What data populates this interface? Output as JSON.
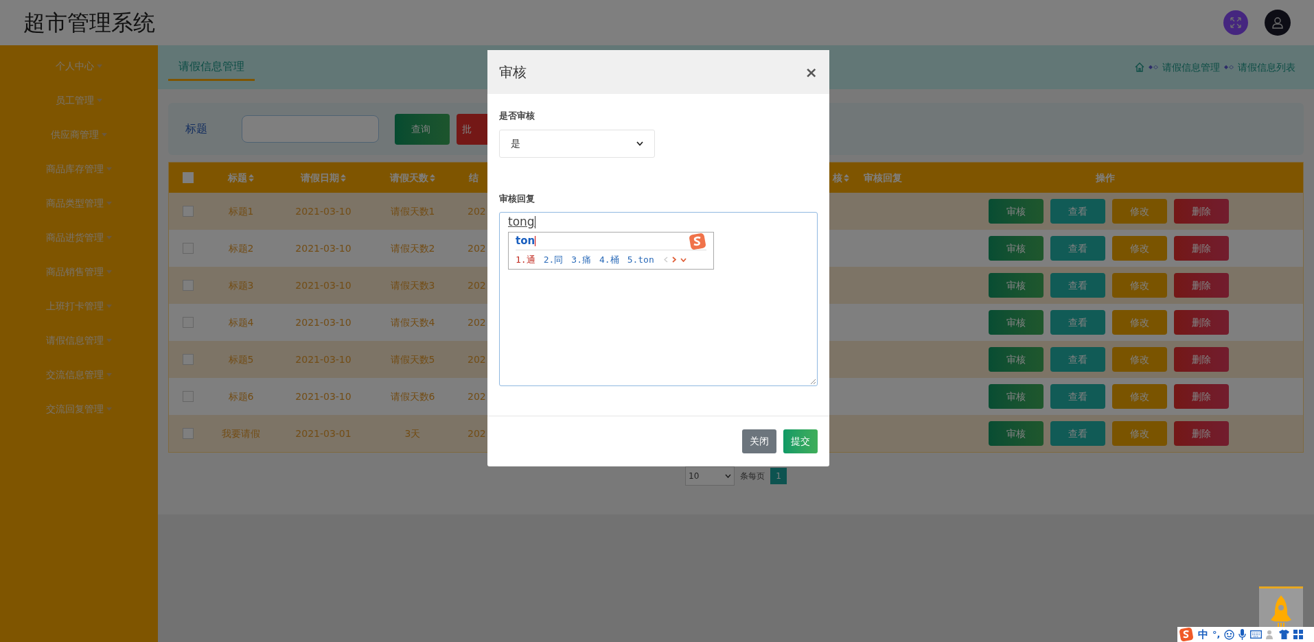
{
  "header": {
    "title": "超市管理系统"
  },
  "sidebar": {
    "items": [
      {
        "label": "个人中心"
      },
      {
        "label": "员工管理"
      },
      {
        "label": "供应商管理"
      },
      {
        "label": "商品库存管理"
      },
      {
        "label": "商品类型管理"
      },
      {
        "label": "商品进货管理"
      },
      {
        "label": "商品销售管理"
      },
      {
        "label": "上班打卡管理"
      },
      {
        "label": "请假信息管理"
      },
      {
        "label": "交流信息管理"
      },
      {
        "label": "交流回复管理"
      }
    ]
  },
  "tabs": [
    {
      "label": "请假信息管理",
      "selected": true
    }
  ],
  "breadcrumb": [
    "请假信息管理",
    "请假信息列表"
  ],
  "search": {
    "label": "标题",
    "buttons": [
      {
        "label": "查询",
        "kind": "query"
      },
      {
        "label": "批",
        "kind": "batch"
      }
    ]
  },
  "table": {
    "checked": false,
    "columns": [
      {
        "label": "标题",
        "sortable": true
      },
      {
        "label": "请假日期",
        "sortable": true
      },
      {
        "label": "请假天数",
        "sortable": true
      },
      {
        "label": "结",
        "sortable": false
      },
      {
        "label": "核",
        "sortable": true
      },
      {
        "label": "审核回复",
        "sortable": false
      },
      {
        "label": "操作",
        "sortable": false
      }
    ],
    "rows": [
      {
        "checked": false,
        "cells": [
          "标题1",
          "2021-03-10",
          "请假天数1",
          "202"
        ],
        "actions": [
          {
            "label": "审核",
            "kind": "review"
          },
          {
            "label": "查看",
            "kind": "view"
          },
          {
            "label": "修改",
            "kind": "edit"
          },
          {
            "label": "删除",
            "kind": "delete"
          }
        ]
      },
      {
        "checked": false,
        "cells": [
          "标题2",
          "2021-03-10",
          "请假天数2",
          "202"
        ],
        "actions": [
          {
            "label": "审核",
            "kind": "review"
          },
          {
            "label": "查看",
            "kind": "view"
          },
          {
            "label": "修改",
            "kind": "edit"
          },
          {
            "label": "删除",
            "kind": "delete"
          }
        ]
      },
      {
        "checked": false,
        "cells": [
          "标题3",
          "2021-03-10",
          "请假天数3",
          "202"
        ],
        "actions": [
          {
            "label": "审核",
            "kind": "review"
          },
          {
            "label": "查看",
            "kind": "view"
          },
          {
            "label": "修改",
            "kind": "edit"
          },
          {
            "label": "删除",
            "kind": "delete"
          }
        ]
      },
      {
        "checked": false,
        "cells": [
          "标题4",
          "2021-03-10",
          "请假天数4",
          "202"
        ],
        "actions": [
          {
            "label": "审核",
            "kind": "review"
          },
          {
            "label": "查看",
            "kind": "view"
          },
          {
            "label": "修改",
            "kind": "edit"
          },
          {
            "label": "删除",
            "kind": "delete"
          }
        ]
      },
      {
        "checked": false,
        "cells": [
          "标题5",
          "2021-03-10",
          "请假天数5",
          "202"
        ],
        "actions": [
          {
            "label": "审核",
            "kind": "review"
          },
          {
            "label": "查看",
            "kind": "view"
          },
          {
            "label": "修改",
            "kind": "edit"
          },
          {
            "label": "删除",
            "kind": "delete"
          }
        ]
      },
      {
        "checked": false,
        "cells": [
          "标题6",
          "2021-03-10",
          "请假天数6",
          "202"
        ],
        "actions": [
          {
            "label": "审核",
            "kind": "review"
          },
          {
            "label": "查看",
            "kind": "view"
          },
          {
            "label": "修改",
            "kind": "edit"
          },
          {
            "label": "删除",
            "kind": "delete"
          }
        ]
      },
      {
        "checked": false,
        "cells": [
          "我要请假",
          "2021-03-01",
          "3天",
          "202"
        ],
        "actions": [
          {
            "label": "审核",
            "kind": "review"
          },
          {
            "label": "查看",
            "kind": "view"
          },
          {
            "label": "修改",
            "kind": "edit"
          },
          {
            "label": "删除",
            "kind": "delete"
          }
        ]
      }
    ]
  },
  "pagination": {
    "page_size": "10",
    "page_size_label": "条每页",
    "pages": [
      {
        "label": "1",
        "selected": true
      }
    ]
  },
  "modal": {
    "title": "审核",
    "close": "×",
    "fields": [
      {
        "kind": "select",
        "label": "是否审核",
        "value": "是"
      },
      {
        "kind": "textarea",
        "label": "审核回复",
        "value": "tong"
      }
    ],
    "buttons": [
      {
        "label": "关闭",
        "kind": "secondary"
      },
      {
        "label": "提交",
        "kind": "primary"
      }
    ]
  },
  "ime_popup": {
    "composition": "ton",
    "candidates": [
      {
        "label": "1.通",
        "selected": true
      },
      {
        "label": "2.同",
        "selected": false
      },
      {
        "label": "3.痛",
        "selected": false
      },
      {
        "label": "4.桶",
        "selected": false
      },
      {
        "label": "5.ton",
        "selected": false
      }
    ]
  },
  "ime_toolbar": {
    "mode": "中",
    "punctuation": "°,"
  }
}
